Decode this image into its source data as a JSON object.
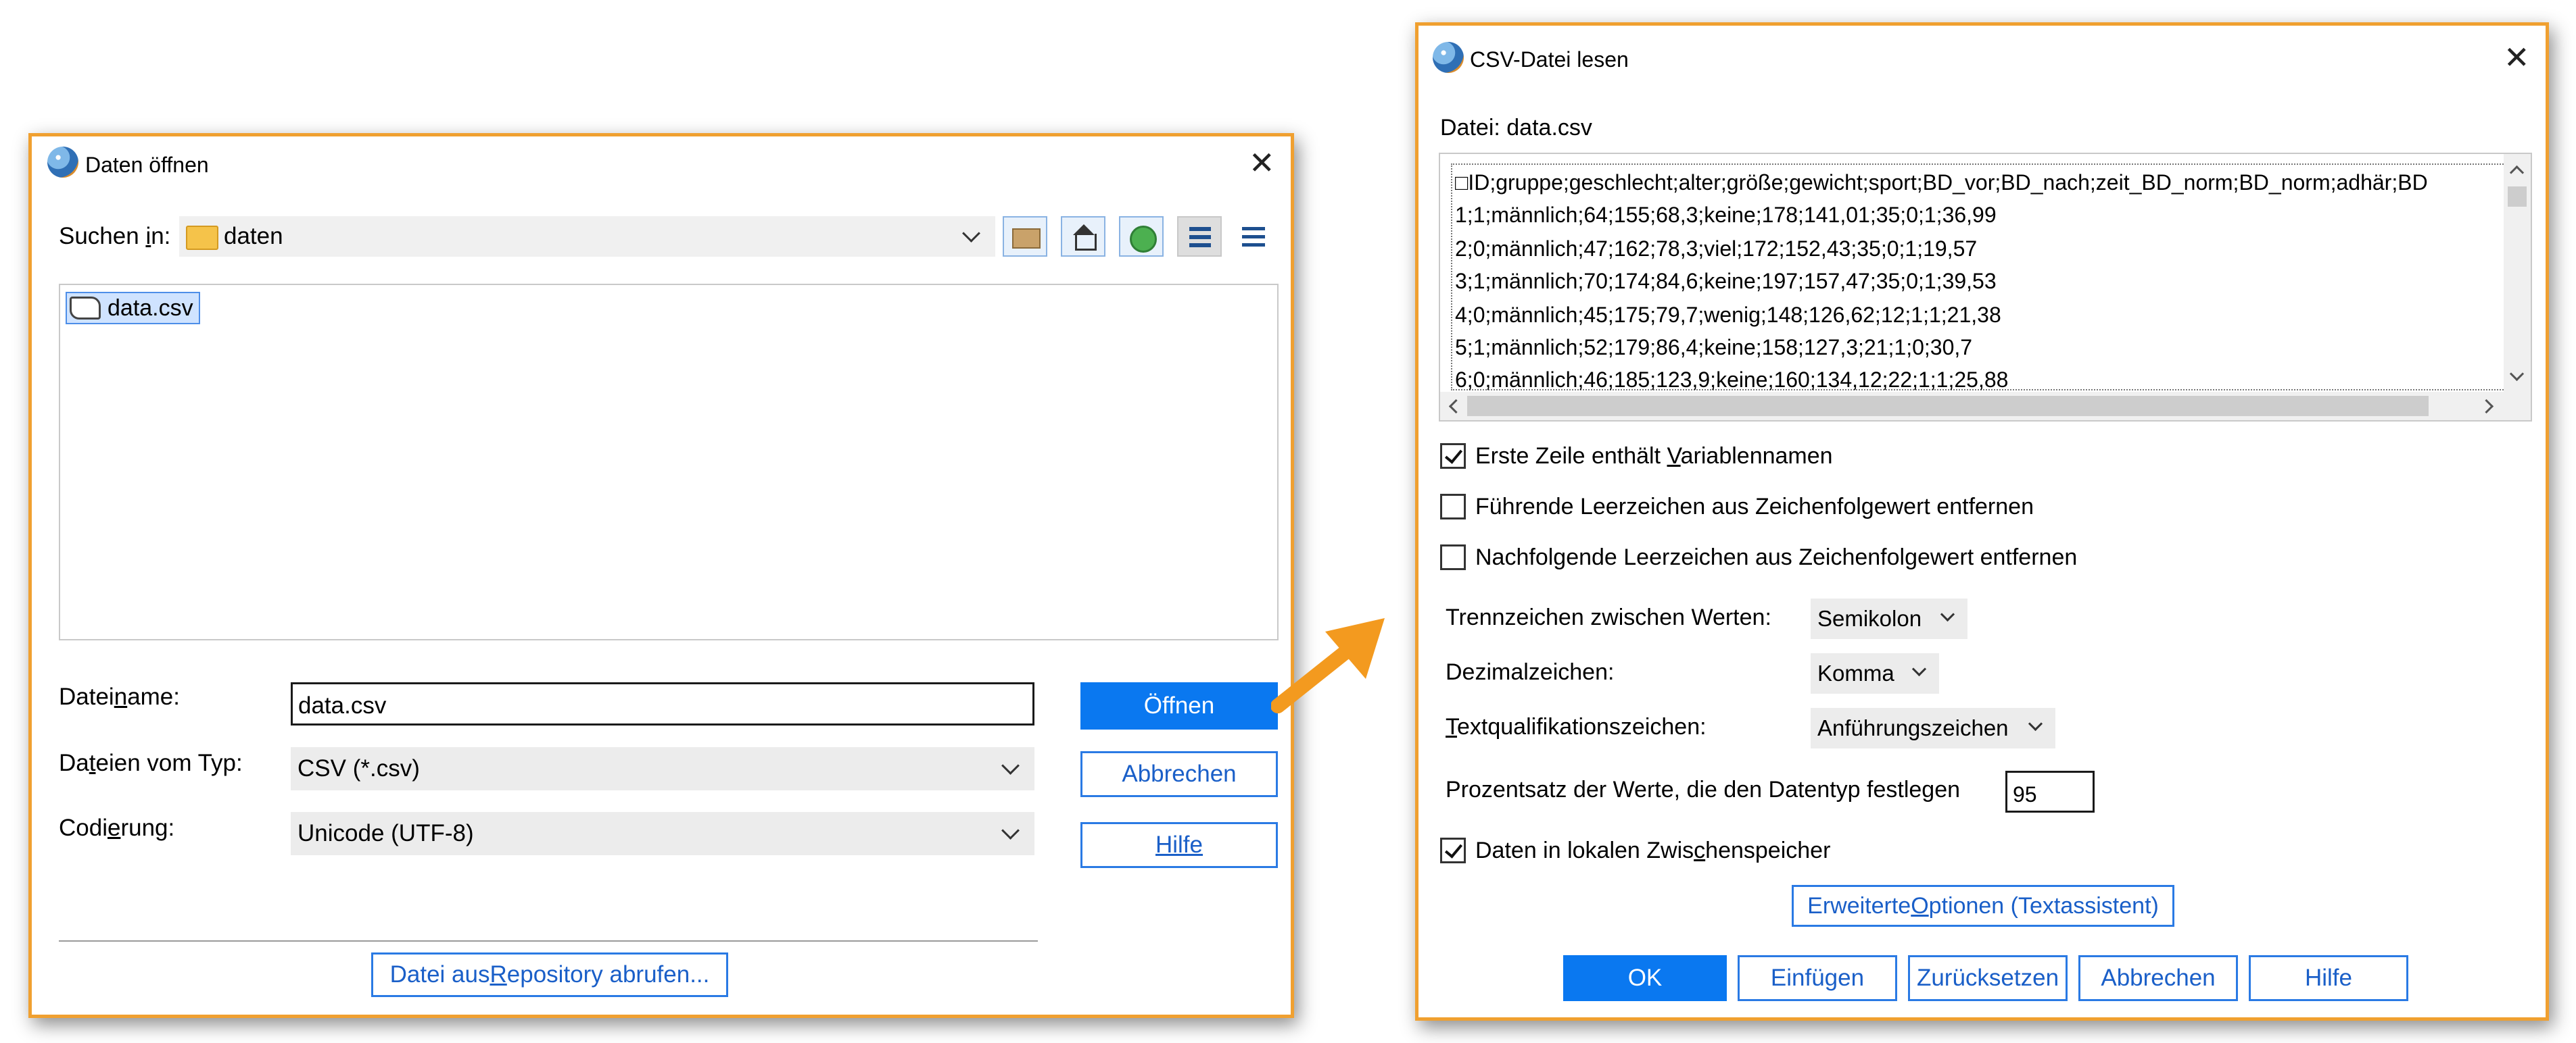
{
  "open_dialog": {
    "title": "Daten öffnen",
    "look_in_label_pre": "Suchen ",
    "look_in_label_u": "i",
    "look_in_label_post": "n:",
    "look_in_value": "daten",
    "selected_file": "data.csv",
    "filename_label_pre": "Datei",
    "filename_label_u": "n",
    "filename_label_post": "ame:",
    "filename_value": "data.csv",
    "filetype_label_pre": "Da",
    "filetype_label_u": "t",
    "filetype_label_post": "eien vom Typ:",
    "filetype_value": "CSV (*.csv)",
    "encoding_label_pre": "Codi",
    "encoding_label_u": "e",
    "encoding_label_post": "rung:",
    "encoding_value": "Unicode (UTF-8)",
    "open_button": "Öffnen",
    "cancel_button": "Abbrechen",
    "help_button": "Hilfe",
    "repository_pre": "Datei aus ",
    "repository_u": "R",
    "repository_post": "epository abrufen..."
  },
  "csv_dialog": {
    "title": "CSV-Datei lesen",
    "file_label": "Datei: data.csv",
    "preview_lines": [
      "□ID;gruppe;geschlecht;alter;größe;gewicht;sport;BD_vor;BD_nach;zeit_BD_norm;BD_norm;adhär;BD",
      "1;1;männlich;64;155;68,3;keine;178;141,01;35;0;1;36,99",
      "2;0;männlich;47;162;78,3;viel;172;152,43;35;0;1;19,57",
      "3;1;männlich;70;174;84,6;keine;197;157,47;35;0;1;39,53",
      "4;0;männlich;45;175;79,7;wenig;148;126,62;12;1;1;21,38",
      "5;1;männlich;52;179;86,4;keine;158;127,3;21;1;0;30,7",
      "6;0;männlich;46;185;123,9;keine;160;134,12;22;1;1;25,88"
    ],
    "opt_first_row_pre": "Erste Zeile enthält ",
    "opt_first_row_u": "V",
    "opt_first_row_post": "ariablennamen",
    "opt_leading": "Führende Leerzeichen aus Zeichenfolgewert entfernen",
    "opt_trailing": "Nachfolgende Leerzeichen aus Zeichenfolgewert entfernen",
    "delimiter_label": "Trennzeichen zwischen Werten:",
    "delimiter_value": "Semikolon",
    "decimal_label": "Dezimalzeichen:",
    "decimal_value": "Komma",
    "text_qual_label_u": "T",
    "text_qual_label_post": "extqualifikationszeichen:",
    "text_qual_value": "Anführungszeichen",
    "percent_label": "Prozentsatz der Werte, die den Datentyp festlegen",
    "percent_value": "95",
    "cache_pre": "Daten in lokalen Zwis",
    "cache_u": "c",
    "cache_post": "henspeicher",
    "advanced_pre": "Erweiterte ",
    "advanced_u": "O",
    "advanced_post": "ptionen (Textassistent)",
    "ok_button": "OK",
    "paste_button": "Einfügen",
    "reset_button": "Zurücksetzen",
    "cancel_button": "Abbrechen",
    "help_button": "Hilfe"
  },
  "colors": {
    "accent_border": "#f0a030",
    "primary_button": "#0a78f0",
    "arrow": "#f39a1f"
  }
}
